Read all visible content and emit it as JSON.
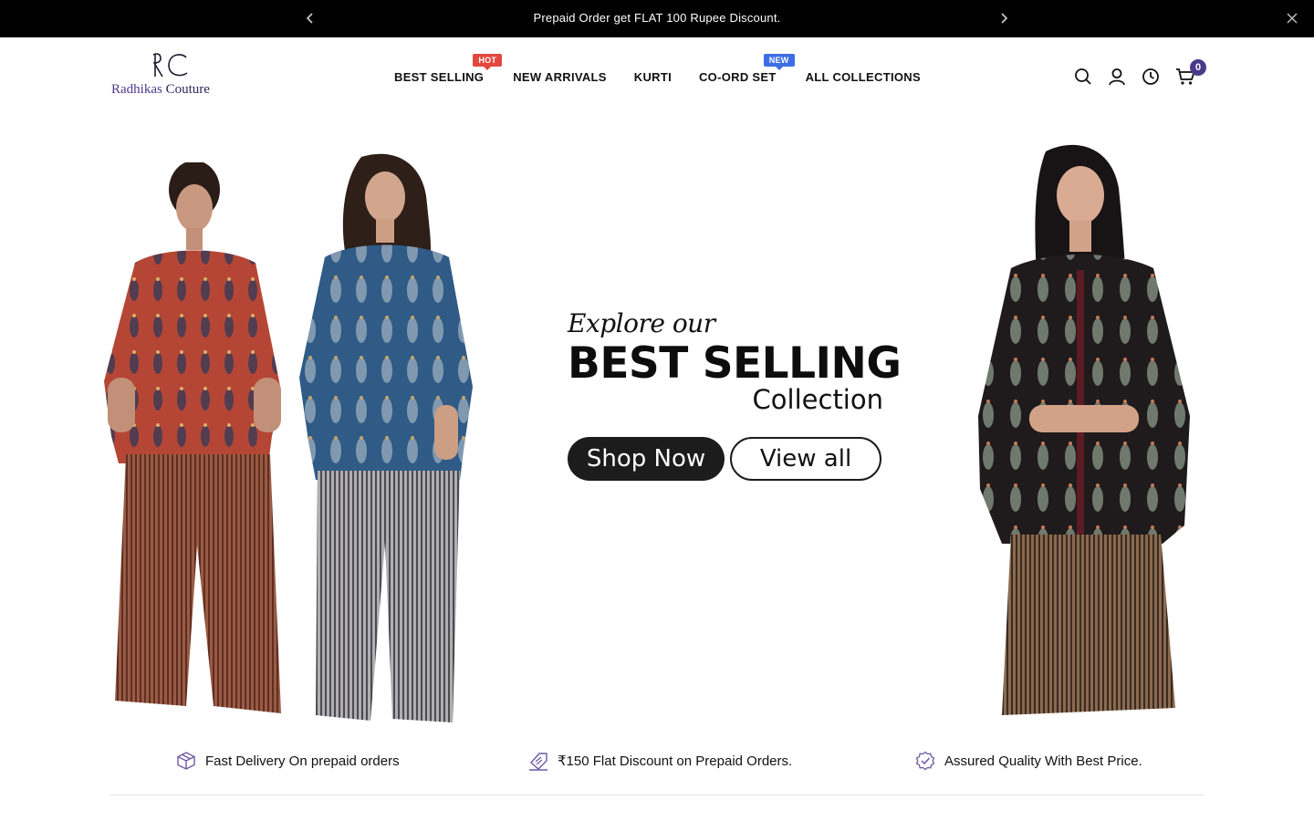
{
  "announcement": {
    "message": "Prepaid Order get FLAT 100 Rupee Discount."
  },
  "header": {
    "brand_first": "Radhikas",
    "brand_second": "Couture",
    "nav": [
      {
        "label": "BEST SELLING",
        "badge": "HOT"
      },
      {
        "label": "NEW ARRIVALS"
      },
      {
        "label": "KURTI"
      },
      {
        "label": "CO-ORD SET",
        "badge": "NEW"
      },
      {
        "label": "ALL COLLECTIONS"
      }
    ],
    "cart_count": "0"
  },
  "hero": {
    "script_line": "Explore our",
    "headline": "BEST SELLING",
    "subline": "Collection",
    "primary_cta": "Shop Now",
    "secondary_cta": "View all"
  },
  "features": [
    {
      "text": "Fast Delivery On prepaid orders",
      "icon": "box-icon"
    },
    {
      "text": "₹150 Flat Discount on Prepaid Orders.",
      "icon": "discount-tag-icon"
    },
    {
      "text": "Assured Quality With Best Price.",
      "icon": "quality-badge-icon"
    }
  ],
  "colors": {
    "brand": "#4b3a8c",
    "hot_badge": "#e2483d",
    "new_badge": "#3e6ee4",
    "announcement_bg": "#000000"
  }
}
